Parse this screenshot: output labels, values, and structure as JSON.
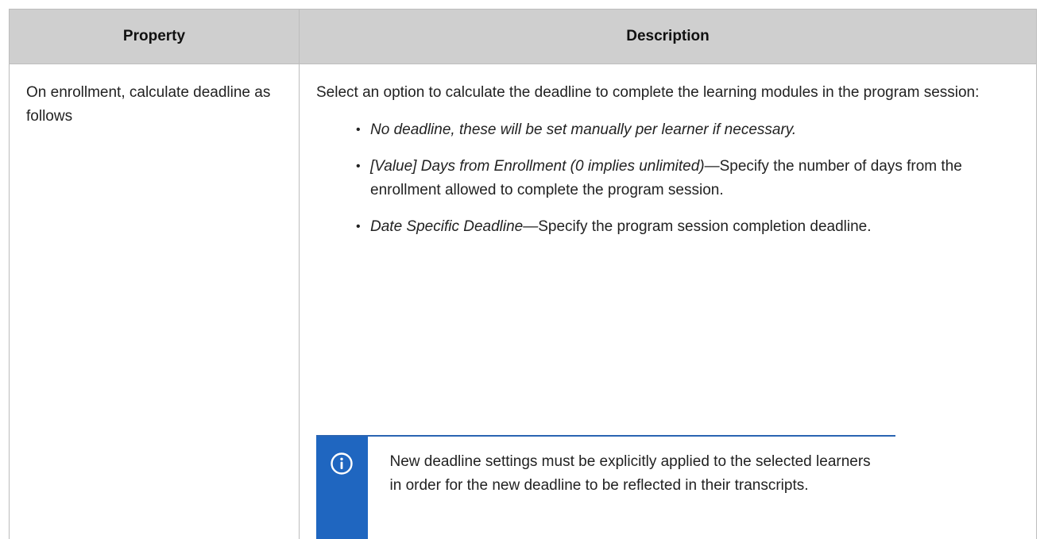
{
  "table": {
    "headers": {
      "property": "Property",
      "description": "Description"
    },
    "row": {
      "property": "On enrollment, calculate deadline as follows",
      "intro": "Select an option to calculate the deadline to complete the learning modules in the program session:",
      "options": [
        {
          "bullet": "•",
          "term": "No deadline, these will be set manually per learner if necessary.",
          "description": ""
        },
        {
          "bullet": "•",
          "term": "[Value] Days from Enrollment (0 implies unlimited)",
          "description": "—Specify the number of days from the enrollment allowed to complete the program session."
        },
        {
          "bullet": "•",
          "term": "Date Specific Deadline",
          "description": "—Specify the program session completion deadline."
        }
      ],
      "note": {
        "icon": "info-icon",
        "text": "New deadline settings must be explicitly applied to the selected learners in order for the new deadline to be reflected in their transcripts."
      }
    }
  },
  "colors": {
    "header_bg": "#cfcfcf",
    "note_accent": "#1f66c0",
    "note_border": "#2a64b2"
  }
}
